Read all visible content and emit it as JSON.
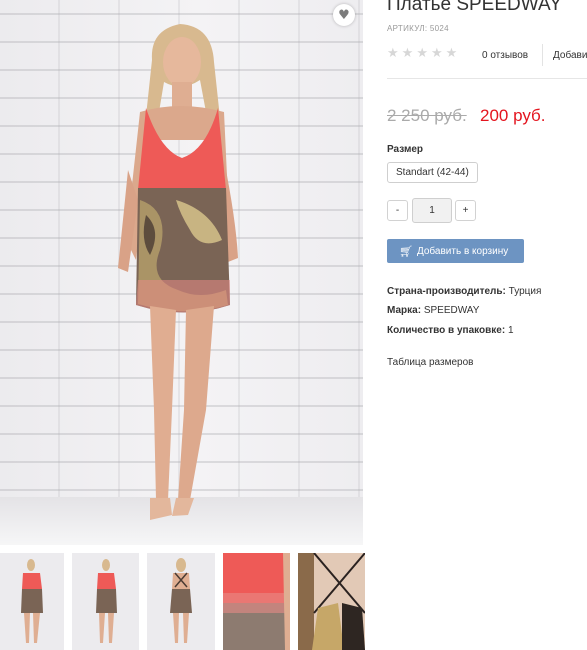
{
  "product": {
    "title": "Платье SPEEDWAY",
    "sku": "АРТИКУЛ: 5024",
    "rating": 0,
    "rating_max": 5,
    "reviews_label": "0 отзывов",
    "add_review_label": "Добавить отзыв",
    "old_price": "2 250 руб.",
    "new_price": "200 руб.",
    "size_label": "Размер",
    "size_option": "Standart (42-44)",
    "quantity": "1",
    "qty_minus": "-",
    "qty_plus": "+",
    "add_to_cart_label": "Добавить в корзину",
    "properties": [
      {
        "name": "Страна-производитель:",
        "value": "Турция"
      },
      {
        "name": "Марка:",
        "value": "SPEEDWAY"
      },
      {
        "name": "Количество в упаковке:",
        "value": "1"
      }
    ],
    "size_table_link": "Таблица размеров"
  },
  "icons": {
    "wishlist": "heart-icon",
    "cart": "cart-icon",
    "star": "star-icon"
  },
  "colors": {
    "price_accent": "#e4151f",
    "button": "#6d94c2",
    "dress_coral": "#ee5a57"
  },
  "thumbnails": [
    {
      "name": "front view"
    },
    {
      "name": "front view 2"
    },
    {
      "name": "back view"
    },
    {
      "name": "fabric detail"
    },
    {
      "name": "back straps detail"
    }
  ]
}
